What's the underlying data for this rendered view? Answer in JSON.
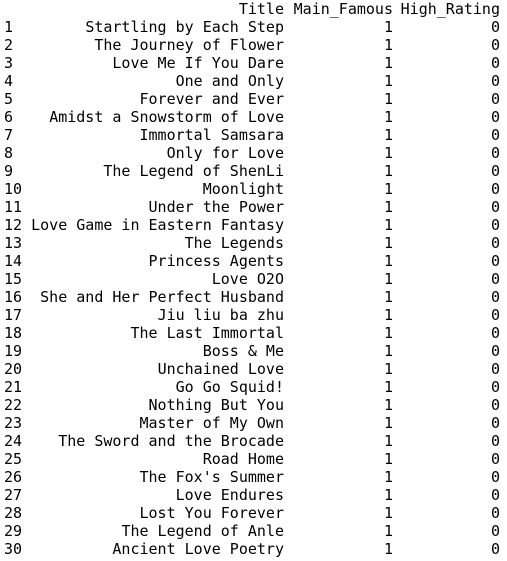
{
  "table": {
    "columns": [
      "Title",
      "Main_Famous",
      "High_Rating"
    ],
    "rows": [
      {
        "index": "1",
        "title": "Startling by Each Step",
        "main_famous": "1",
        "high_rating": "0"
      },
      {
        "index": "2",
        "title": "The Journey of Flower",
        "main_famous": "1",
        "high_rating": "0"
      },
      {
        "index": "3",
        "title": "Love Me If You Dare",
        "main_famous": "1",
        "high_rating": "0"
      },
      {
        "index": "4",
        "title": "One and Only",
        "main_famous": "1",
        "high_rating": "0"
      },
      {
        "index": "5",
        "title": "Forever and Ever",
        "main_famous": "1",
        "high_rating": "0"
      },
      {
        "index": "6",
        "title": "Amidst a Snowstorm of Love",
        "main_famous": "1",
        "high_rating": "0"
      },
      {
        "index": "7",
        "title": "Immortal Samsara",
        "main_famous": "1",
        "high_rating": "0"
      },
      {
        "index": "8",
        "title": "Only for Love",
        "main_famous": "1",
        "high_rating": "0"
      },
      {
        "index": "9",
        "title": "The Legend of ShenLi",
        "main_famous": "1",
        "high_rating": "0"
      },
      {
        "index": "10",
        "title": "Moonlight",
        "main_famous": "1",
        "high_rating": "0"
      },
      {
        "index": "11",
        "title": "Under the Power",
        "main_famous": "1",
        "high_rating": "0"
      },
      {
        "index": "12",
        "title": "Love Game in Eastern Fantasy",
        "main_famous": "1",
        "high_rating": "0"
      },
      {
        "index": "13",
        "title": "The Legends",
        "main_famous": "1",
        "high_rating": "0"
      },
      {
        "index": "14",
        "title": "Princess Agents",
        "main_famous": "1",
        "high_rating": "0"
      },
      {
        "index": "15",
        "title": "Love O2O",
        "main_famous": "1",
        "high_rating": "0"
      },
      {
        "index": "16",
        "title": "She and Her Perfect Husband",
        "main_famous": "1",
        "high_rating": "0"
      },
      {
        "index": "17",
        "title": "Jiu liu ba zhu",
        "main_famous": "1",
        "high_rating": "0"
      },
      {
        "index": "18",
        "title": "The Last Immortal",
        "main_famous": "1",
        "high_rating": "0"
      },
      {
        "index": "19",
        "title": "Boss & Me",
        "main_famous": "1",
        "high_rating": "0"
      },
      {
        "index": "20",
        "title": "Unchained Love",
        "main_famous": "1",
        "high_rating": "0"
      },
      {
        "index": "21",
        "title": "Go Go Squid!",
        "main_famous": "1",
        "high_rating": "0"
      },
      {
        "index": "22",
        "title": "Nothing But You",
        "main_famous": "1",
        "high_rating": "0"
      },
      {
        "index": "23",
        "title": "Master of My Own",
        "main_famous": "1",
        "high_rating": "0"
      },
      {
        "index": "24",
        "title": "The Sword and the Brocade",
        "main_famous": "1",
        "high_rating": "0"
      },
      {
        "index": "25",
        "title": "Road Home",
        "main_famous": "1",
        "high_rating": "0"
      },
      {
        "index": "26",
        "title": "The Fox's Summer",
        "main_famous": "1",
        "high_rating": "0"
      },
      {
        "index": "27",
        "title": "Love Endures",
        "main_famous": "1",
        "high_rating": "0"
      },
      {
        "index": "28",
        "title": "Lost You Forever",
        "main_famous": "1",
        "high_rating": "0"
      },
      {
        "index": "29",
        "title": "The Legend of Anle",
        "main_famous": "1",
        "high_rating": "0"
      },
      {
        "index": "30",
        "title": "Ancient Love Poetry",
        "main_famous": "1",
        "high_rating": "0"
      }
    ]
  }
}
